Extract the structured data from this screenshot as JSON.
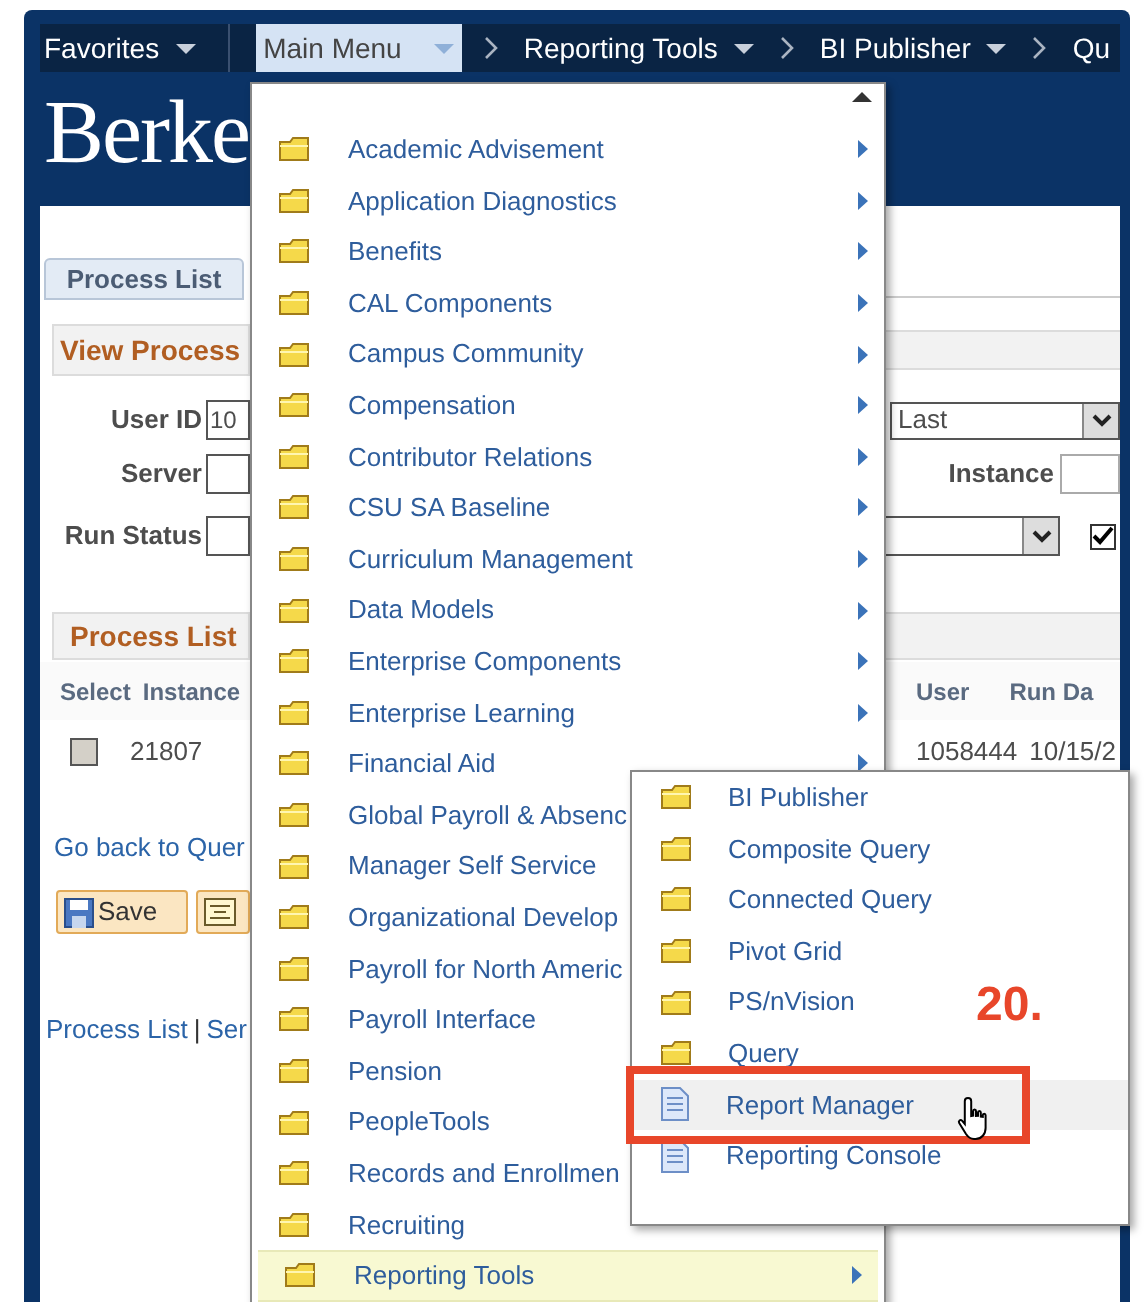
{
  "nav_bar": {
    "items": [
      {
        "label": "Favorites",
        "selected": false,
        "caret": true,
        "crumb": false
      },
      {
        "label": "Main Menu",
        "selected": true,
        "caret": true,
        "crumb": false
      },
      {
        "label": "Reporting Tools",
        "selected": false,
        "caret": true,
        "crumb": true
      },
      {
        "label": "BI Publisher",
        "selected": false,
        "caret": true,
        "crumb": true
      },
      {
        "label": "Qu",
        "selected": false,
        "caret": false,
        "crumb": true
      }
    ]
  },
  "logo": {
    "text": "Berke"
  },
  "page": {
    "tab": {
      "label": "Process List",
      "selected": true
    },
    "section_title": "View Process",
    "filters": [
      {
        "label": "User ID",
        "value": "10"
      },
      {
        "label": "Server"
      },
      {
        "label": "Run Status"
      }
    ],
    "right_filters": {
      "select_value": "Last",
      "instance_label": "Instance",
      "checked": true
    },
    "grid": {
      "title": "Process List",
      "columns_left": [
        "Select",
        "Instance"
      ],
      "columns_right": [
        "User",
        "Run Da"
      ],
      "row": {
        "checked": false,
        "instance": "21807",
        "user": "1058444",
        "run_date": "10/15/2"
      }
    },
    "back_link": "Go back to Quer",
    "buttons": [
      {
        "kind": "save",
        "label": "Save"
      },
      {
        "kind": "notes"
      }
    ],
    "footer_links": [
      "Process List",
      "Ser"
    ],
    "footer_separator": "|"
  },
  "main_menu": {
    "items": [
      {
        "label": "Academic Advisement",
        "arrow": true,
        "selected": false
      },
      {
        "label": "Application Diagnostics",
        "arrow": true,
        "selected": false
      },
      {
        "label": "Benefits",
        "arrow": true,
        "selected": false
      },
      {
        "label": "CAL Components",
        "arrow": true,
        "selected": false
      },
      {
        "label": "Campus Community",
        "arrow": true,
        "selected": false
      },
      {
        "label": "Compensation",
        "arrow": true,
        "selected": false
      },
      {
        "label": "Contributor Relations",
        "arrow": true,
        "selected": false
      },
      {
        "label": "CSU SA Baseline",
        "arrow": true,
        "selected": false
      },
      {
        "label": "Curriculum Management",
        "arrow": true,
        "selected": false
      },
      {
        "label": "Data Models",
        "arrow": true,
        "selected": false
      },
      {
        "label": "Enterprise Components",
        "arrow": true,
        "selected": false
      },
      {
        "label": "Enterprise Learning",
        "arrow": true,
        "selected": false
      },
      {
        "label": "Financial Aid",
        "arrow": true,
        "selected": false
      },
      {
        "label": "Global Payroll & Absenc",
        "arrow": false,
        "selected": false
      },
      {
        "label": "Manager Self Service",
        "arrow": false,
        "selected": false
      },
      {
        "label": "Organizational Develop",
        "arrow": false,
        "selected": false
      },
      {
        "label": "Payroll for North Americ",
        "arrow": false,
        "selected": false
      },
      {
        "label": "Payroll Interface",
        "arrow": false,
        "selected": false
      },
      {
        "label": "Pension",
        "arrow": false,
        "selected": false
      },
      {
        "label": "PeopleTools",
        "arrow": false,
        "selected": false
      },
      {
        "label": "Records and Enrollmen",
        "arrow": false,
        "selected": false
      },
      {
        "label": "Recruiting",
        "arrow": false,
        "selected": false
      },
      {
        "label": "Reporting Tools",
        "arrow": true,
        "selected": true
      }
    ]
  },
  "submenu": {
    "items": [
      {
        "label": "BI Publisher",
        "kind": "folder",
        "selected": false
      },
      {
        "label": "Composite Query",
        "kind": "folder",
        "selected": false
      },
      {
        "label": "Connected Query",
        "kind": "folder",
        "selected": false
      },
      {
        "label": "Pivot Grid",
        "kind": "folder",
        "selected": false
      },
      {
        "label": "PS/nVision",
        "kind": "folder",
        "selected": false
      },
      {
        "label": "Query",
        "kind": "folder",
        "selected": false
      },
      {
        "label": "Report Manager",
        "kind": "page",
        "selected": true
      },
      {
        "label": "Reporting Console",
        "kind": "page",
        "selected": false
      }
    ]
  },
  "annotation": {
    "step": "20."
  }
}
